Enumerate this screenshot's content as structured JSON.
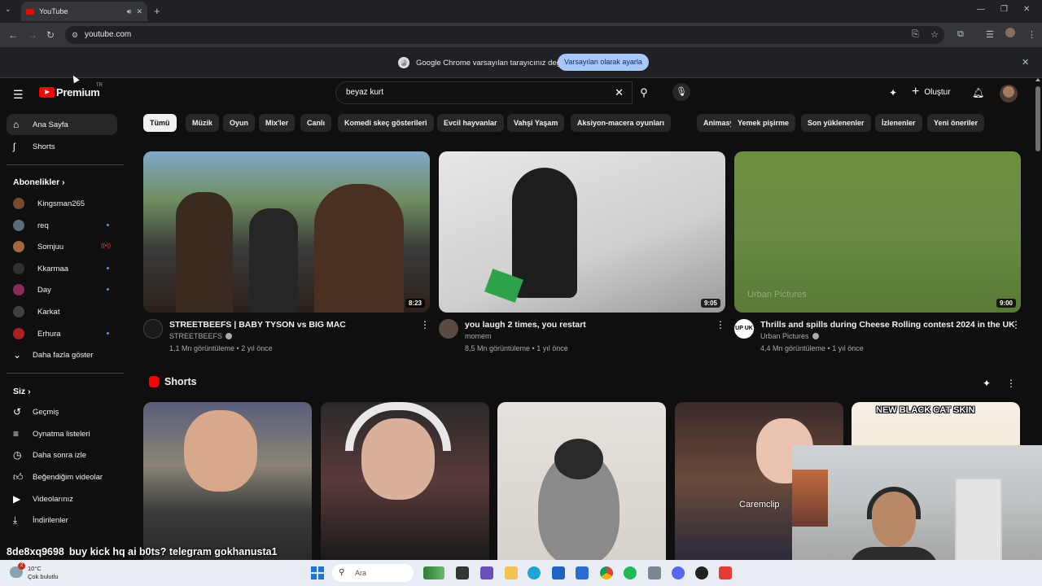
{
  "browser": {
    "tab_title": "YouTube",
    "url": "youtube.com"
  },
  "infobar": {
    "message": "Google Chrome varsayılan tarayıcınız değil",
    "button": "Varsayılan olarak ayarla"
  },
  "header": {
    "logo_text": "Premium",
    "country_code": "TR",
    "search_value": "beyaz kurt",
    "create_label": "Oluştur"
  },
  "sidebar": {
    "home": "Ana Sayfa",
    "shorts": "Shorts",
    "subscriptions_title": "Abonelikler",
    "channels": [
      {
        "name": "Kingsman265",
        "color": "#7a4a2a"
      },
      {
        "name": "req",
        "color": "#5a6b7a"
      },
      {
        "name": "Somjuu",
        "color": "#a5673f"
      },
      {
        "name": "Kkarmaa",
        "color": "#303030"
      },
      {
        "name": "Day",
        "color": "#8a2a5a"
      },
      {
        "name": "Karkat",
        "color": "#404040"
      },
      {
        "name": "Erhura",
        "color": "#b02020"
      }
    ],
    "more": "Daha fazla göster",
    "you_title": "Siz",
    "you_items": [
      "Geçmiş",
      "Oynatma listeleri",
      "Daha sonra izle",
      "Beğendiğim videolar",
      "Videolarınız",
      "İndirilenler"
    ]
  },
  "chips": [
    "Tümü",
    "Müzik",
    "Oyun",
    "Mix'ler",
    "Canlı",
    "Komedi skeç gösterileri",
    "Evcil hayvanlar",
    "Vahşi Yaşam",
    "Aksiyon-macera oyunları",
    "Animasyon",
    "Yemek pişirme",
    "Son yüklenenler",
    "İzlenenler",
    "Yeni öneriler"
  ],
  "videos": [
    {
      "title": "STREETBEEFS | BABY TYSON vs BIG MAC",
      "channel": "STREETBEEFS",
      "stats": "1,1 Mn görüntüleme • 2 yıl önce",
      "duration": "8:23",
      "verified": true
    },
    {
      "title": "you laugh 2 times, you restart",
      "channel": "momem",
      "stats": "8,5 Mn görüntüleme • 1 yıl önce",
      "duration": "9:05",
      "verified": false
    },
    {
      "title": "Thrills and spills during Cheese Rolling contest 2024 in the UK",
      "channel": "Urban Pictures",
      "stats": "4,4 Mn görüntüleme • 1 yıl önce",
      "duration": "9:00",
      "verified": true,
      "watermark": "Urban Pictures",
      "avatar_text": "UP UK"
    }
  ],
  "shorts_section": {
    "title": "Shorts",
    "short4_caption": "Caremclip",
    "short5_caption": "NEW BLACK CAT SKIN"
  },
  "chat_overlay": {
    "user": "8de8xq9698",
    "message": "buy kick hq ai b0ts? telegram gokhanusta1"
  },
  "taskbar": {
    "temp": "10°C",
    "weather": "Çok bulutlu",
    "search_placeholder": "Ara",
    "notif_count": "2"
  }
}
